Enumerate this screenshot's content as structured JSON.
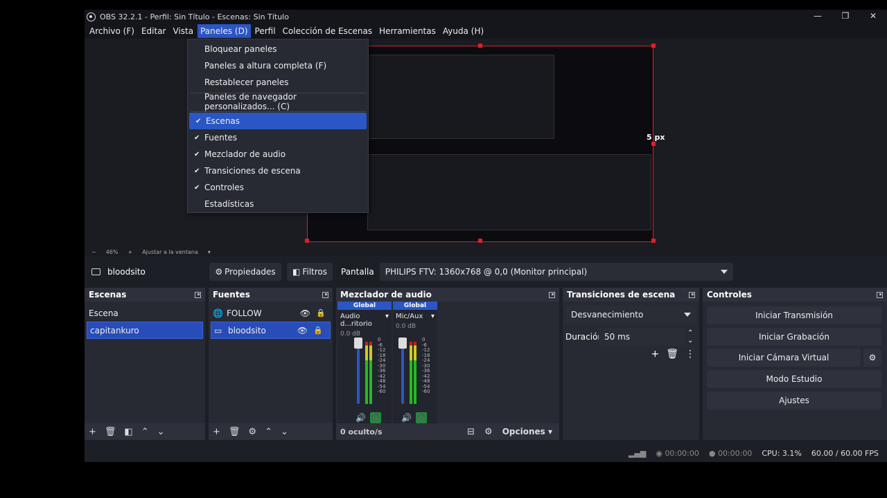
{
  "window": {
    "title": "OBS 32.2.1 - Perfil: Sin Título - Escenas: Sin Título",
    "controls": [
      "—",
      "❐",
      "✕"
    ]
  },
  "menubar": [
    "Archivo (F)",
    "Editar",
    "Vista",
    "Paneles (D)",
    "Perfil",
    "Colección de Escenas",
    "Herramientas",
    "Ayuda (H)"
  ],
  "dropdown": {
    "items": [
      {
        "label": "Bloquear paneles",
        "checked": false
      },
      {
        "label": "Paneles a altura completa (F)",
        "checked": false
      },
      {
        "label": "Restablecer paneles",
        "checked": false
      },
      {
        "label": "Paneles de navegador personalizados... (C)",
        "checked": false
      },
      {
        "label": "Escenas",
        "checked": true,
        "highlighted": true
      },
      {
        "label": "Fuentes",
        "checked": true
      },
      {
        "label": "Mezclador de audio",
        "checked": true
      },
      {
        "label": "Transiciones de escena",
        "checked": true
      },
      {
        "label": "Controles",
        "checked": true
      },
      {
        "label": "Estadísticas",
        "checked": false
      }
    ]
  },
  "preview": {
    "px_label": "5 px",
    "zoom": [
      "−",
      "46%",
      "+",
      "Ajustar a la ventana",
      "▾"
    ]
  },
  "source_toolbar": {
    "source_name": "bloodsito",
    "properties": "Propiedades",
    "filters": "Filtros",
    "display_label": "Pantalla",
    "display_value": "PHILIPS FTV: 1360x768 @ 0,0 (Monitor principal)"
  },
  "scenes": {
    "title": "Escenas",
    "items": [
      "Escena",
      "capitankuro"
    ],
    "selected": "capitankuro"
  },
  "sources": {
    "title": "Fuentes",
    "items": [
      {
        "name": "FOLLOW"
      },
      {
        "name": "bloodsito",
        "selected": true
      }
    ]
  },
  "mixer": {
    "title": "Mezclador de audio",
    "channels": [
      {
        "group": "Global",
        "name": "Audio d...ritorio",
        "db": "0.0 dB"
      },
      {
        "group": "Global",
        "name": "Mic/Aux",
        "db": "0.0 dB"
      }
    ],
    "scale": [
      "0",
      "-6",
      "-12",
      "-18",
      "-24",
      "-30",
      "-36",
      "-42",
      "-48",
      "-54",
      "-60"
    ],
    "hidden": "0 oculto/s",
    "options": "Opciones"
  },
  "transitions": {
    "title": "Transiciones de escena",
    "value": "Desvanecimiento",
    "duration_label": "Duración",
    "duration_value": "50 ms"
  },
  "controls": {
    "title": "Controles",
    "buttons": [
      "Iniciar Transmisión",
      "Iniciar Grabación",
      "Iniciar Cámara Virtual",
      "Modo Estudio",
      "Ajustes"
    ]
  },
  "status": {
    "stream_time": "00:00:00",
    "rec_time": "00:00:00",
    "cpu": "CPU: 3.1%",
    "fps": "60.00 / 60.00 FPS"
  },
  "colors": {
    "accent": "#2a57c5",
    "selection_red": "#e01f24",
    "panel": "#272a33",
    "background": "#1d1f26"
  }
}
